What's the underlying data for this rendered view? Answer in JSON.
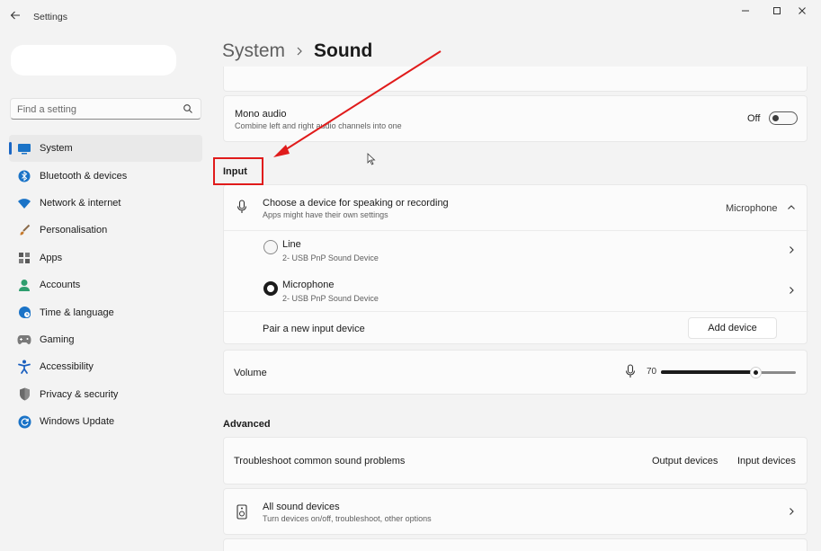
{
  "window": {
    "title": "Settings"
  },
  "sidebar": {
    "search_placeholder": "Find a setting",
    "items": [
      {
        "label": "System",
        "icon": "monitor-icon",
        "color": "#1a73c7"
      },
      {
        "label": "Bluetooth & devices",
        "icon": "bluetooth-icon",
        "color": "#1a73c7"
      },
      {
        "label": "Network & internet",
        "icon": "wifi-icon",
        "color": "#1a73c7"
      },
      {
        "label": "Personalisation",
        "icon": "brush-icon",
        "color": "#c77a2c"
      },
      {
        "label": "Apps",
        "icon": "apps-icon",
        "color": "#5a5a5a"
      },
      {
        "label": "Accounts",
        "icon": "person-icon",
        "color": "#2e9e6e"
      },
      {
        "label": "Time & language",
        "icon": "globe-clock-icon",
        "color": "#1a73c7"
      },
      {
        "label": "Gaming",
        "icon": "gamepad-icon",
        "color": "#7a7a7a"
      },
      {
        "label": "Accessibility",
        "icon": "accessibility-icon",
        "color": "#1a5fbf"
      },
      {
        "label": "Privacy & security",
        "icon": "shield-icon",
        "color": "#6a6a6a"
      },
      {
        "label": "Windows Update",
        "icon": "update-icon",
        "color": "#1a73c7"
      }
    ]
  },
  "header": {
    "parent": "System",
    "current": "Sound"
  },
  "mono_audio": {
    "title": "Mono audio",
    "subtitle": "Combine left and right audio channels into one",
    "state_label": "Off"
  },
  "input": {
    "section_title": "Input",
    "choose": {
      "title": "Choose a device for speaking or recording",
      "subtitle": "Apps might have their own settings",
      "selected": "Microphone"
    },
    "devices": [
      {
        "name": "Line",
        "detail": "2- USB PnP Sound Device",
        "selected": false
      },
      {
        "name": "Microphone",
        "detail": "2- USB PnP Sound Device",
        "selected": true
      }
    ],
    "pair": {
      "title": "Pair a new input device",
      "button": "Add device"
    },
    "volume": {
      "title": "Volume",
      "value": "70",
      "level": 0.7
    }
  },
  "advanced": {
    "section_title": "Advanced",
    "troubleshoot": {
      "title": "Troubleshoot common sound problems",
      "output_link": "Output devices",
      "input_link": "Input devices"
    },
    "all_devices": {
      "title": "All sound devices",
      "subtitle": "Turn devices on/off, troubleshoot, other options"
    }
  },
  "colors": {
    "accent": "#1a66c4",
    "annotation": "#e01b1b"
  }
}
